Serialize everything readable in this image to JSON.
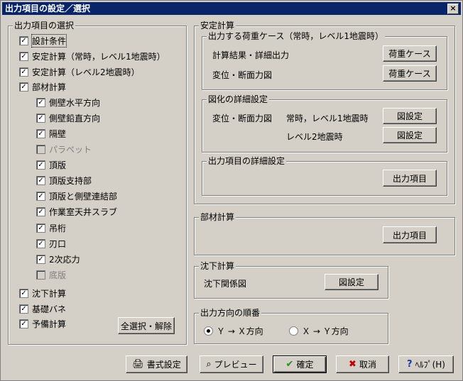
{
  "window": {
    "title": "出力項目の設定／選択",
    "close_glyph": "×"
  },
  "left_group": {
    "title": "出力項目の選択",
    "items": [
      {
        "label": "設計条件",
        "checked": true,
        "enabled": true
      },
      {
        "label": "安定計算（常時，レベル1地震時）",
        "checked": true,
        "enabled": true
      },
      {
        "label": "安定計算（レベル2地震時）",
        "checked": true,
        "enabled": true
      },
      {
        "label": "部材計算",
        "checked": true,
        "enabled": true
      },
      {
        "label": "側壁水平方向",
        "checked": true,
        "enabled": true
      },
      {
        "label": "側壁鉛直方向",
        "checked": true,
        "enabled": true
      },
      {
        "label": "隔壁",
        "checked": true,
        "enabled": true
      },
      {
        "label": "パラペット",
        "checked": false,
        "enabled": false
      },
      {
        "label": "頂版",
        "checked": true,
        "enabled": true
      },
      {
        "label": "頂版支持部",
        "checked": true,
        "enabled": true
      },
      {
        "label": "頂版と側壁連結部",
        "checked": true,
        "enabled": true
      },
      {
        "label": "作業室天井スラブ",
        "checked": true,
        "enabled": true
      },
      {
        "label": "吊桁",
        "checked": true,
        "enabled": true
      },
      {
        "label": "刃口",
        "checked": true,
        "enabled": true
      },
      {
        "label": "2次応力",
        "checked": true,
        "enabled": true
      },
      {
        "label": "底版",
        "checked": false,
        "enabled": false
      },
      {
        "label": "沈下計算",
        "checked": true,
        "enabled": true
      },
      {
        "label": "基礎バネ",
        "checked": true,
        "enabled": true
      },
      {
        "label": "予備計算",
        "checked": true,
        "enabled": true
      }
    ],
    "select_all_label": "全選択・解除"
  },
  "stability": {
    "title": "安定計算",
    "load_case": {
      "title": "出力する荷重ケース（常時，レベル1地震時）",
      "row1_label": "計算結果・詳細出力",
      "row1_button": "荷重ケース",
      "row2_label": "変位・断面力図",
      "row2_button": "荷重ケース"
    },
    "figure": {
      "title": "図化の詳細設定",
      "row_label": "変位・断面力図",
      "sub1": "常時，レベル1地震時",
      "sub1_button": "図設定",
      "sub2": "レベル2地震時",
      "sub2_button": "図設定"
    },
    "output_detail": {
      "title": "出力項目の詳細設定",
      "button": "出力項目"
    }
  },
  "member": {
    "title": "部材計算",
    "button": "出力項目"
  },
  "settlement": {
    "title": "沈下計算",
    "label": "沈下関係図",
    "button": "図設定"
  },
  "direction": {
    "title": "出力方向の順番",
    "opt1": "Ｙ → Ｘ方向",
    "opt2": "Ｘ → Ｙ方向",
    "selected": "opt1"
  },
  "footer": {
    "format_label": "書式設定",
    "preview_label": "プレビュー",
    "ok_label": "確定",
    "cancel_label": "取消",
    "help_label": "ﾍﾙﾌﾟ(H)",
    "format_icon": "printer-icon",
    "preview_icon": "magnifier-icon",
    "ok_icon": "checkmark-icon",
    "cancel_icon": "x-icon",
    "help_icon": "question-icon"
  }
}
